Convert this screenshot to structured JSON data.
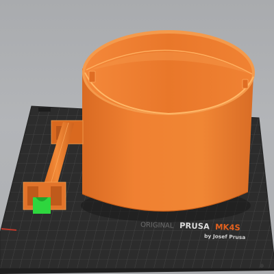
{
  "scene": {
    "bed": {
      "brand_prefix": "ORIGINAL",
      "brand_name": "PRUSA",
      "brand_model": "MK4S",
      "brand_byline": "by Josef Prusa"
    },
    "colors": {
      "background": "#aeb0b3",
      "bed_surface": "#2c2c2c",
      "grid_line": "#5a5a5a",
      "filament_orange": "#f0802f",
      "filament_highlight": "#ffb060",
      "selected_part": "#2ed63e",
      "bed_text_orange": "#e2611f",
      "bed_text_gray": "#d8d8d8"
    }
  }
}
